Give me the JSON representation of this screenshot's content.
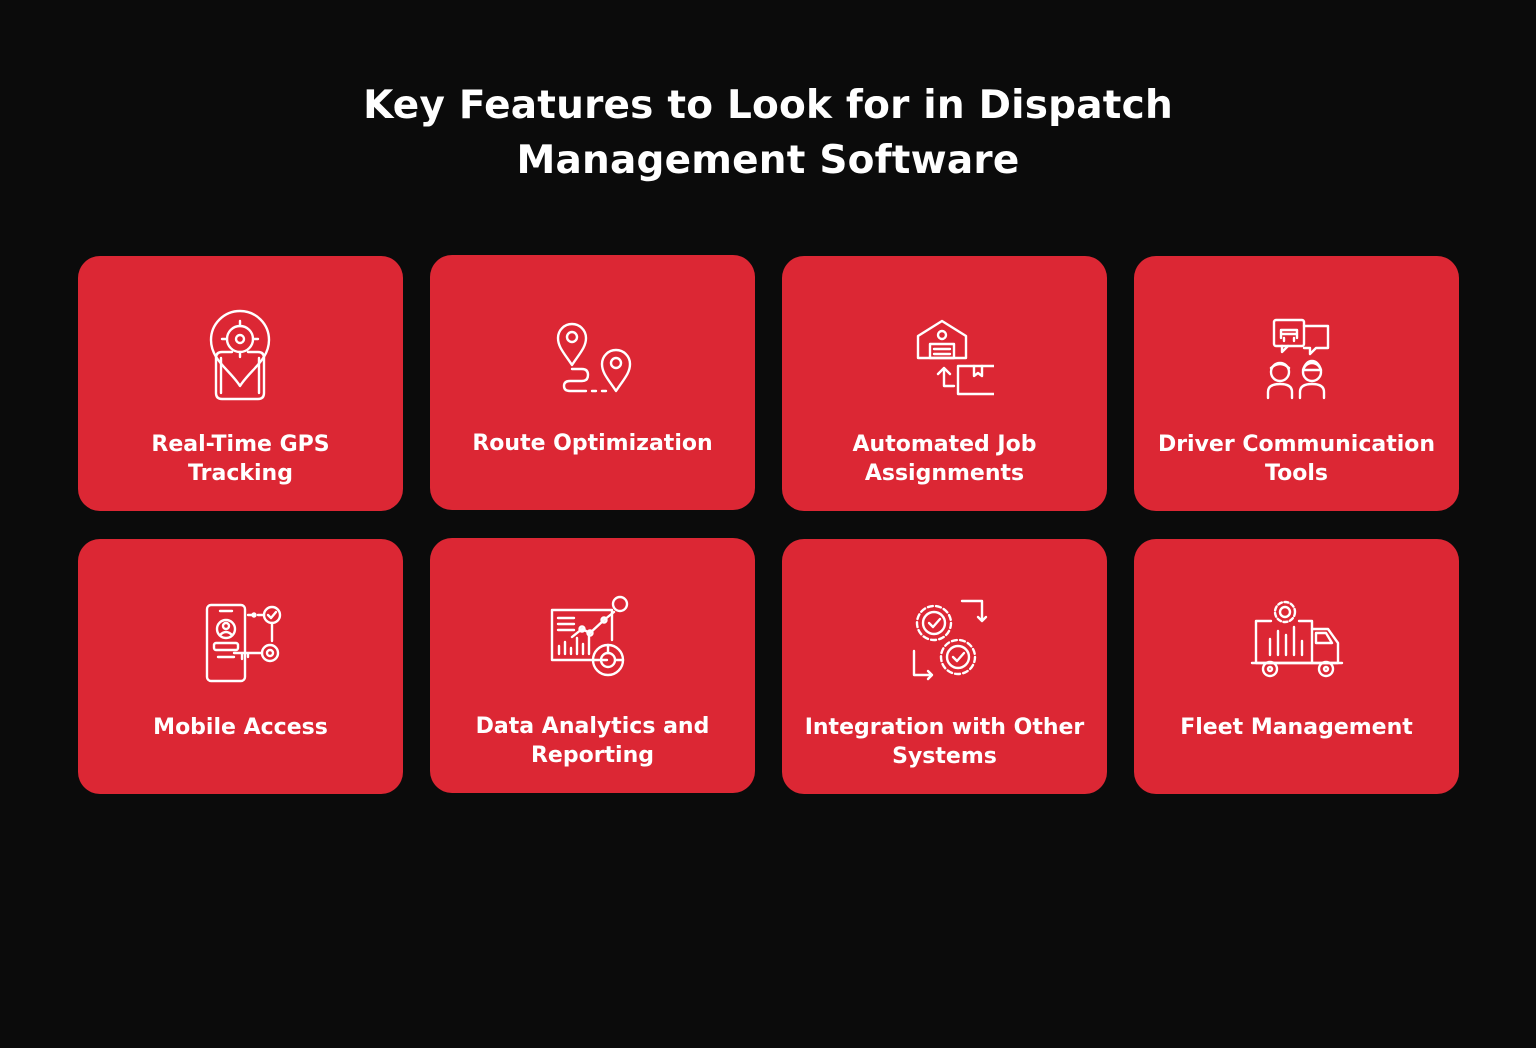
{
  "header": {
    "title_line1": "Key Features to Look for in Dispatch",
    "title_line2": "Management Software"
  },
  "colors": {
    "background": "#0b0b0b",
    "card": "#dc2734",
    "text": "#ffffff"
  },
  "features": [
    {
      "icon": "gps-tracking-icon",
      "line1": "Real-Time GPS",
      "line2": "Tracking"
    },
    {
      "icon": "route-optimization-icon",
      "line1": "Route Optimization",
      "line2": ""
    },
    {
      "icon": "warehouse-package-icon",
      "line1": "Automated Job",
      "line2": "Assignments"
    },
    {
      "icon": "driver-communication-icon",
      "line1": "Driver Communication",
      "line2": "Tools"
    },
    {
      "icon": "mobile-access-icon",
      "line1": "Mobile Access",
      "line2": ""
    },
    {
      "icon": "data-analytics-icon",
      "line1": "Data Analytics and",
      "line2": "Reporting"
    },
    {
      "icon": "integration-gears-icon",
      "line1": "Integration with Other",
      "line2": "Systems"
    },
    {
      "icon": "fleet-truck-icon",
      "line1": "Fleet Management",
      "line2": ""
    }
  ]
}
